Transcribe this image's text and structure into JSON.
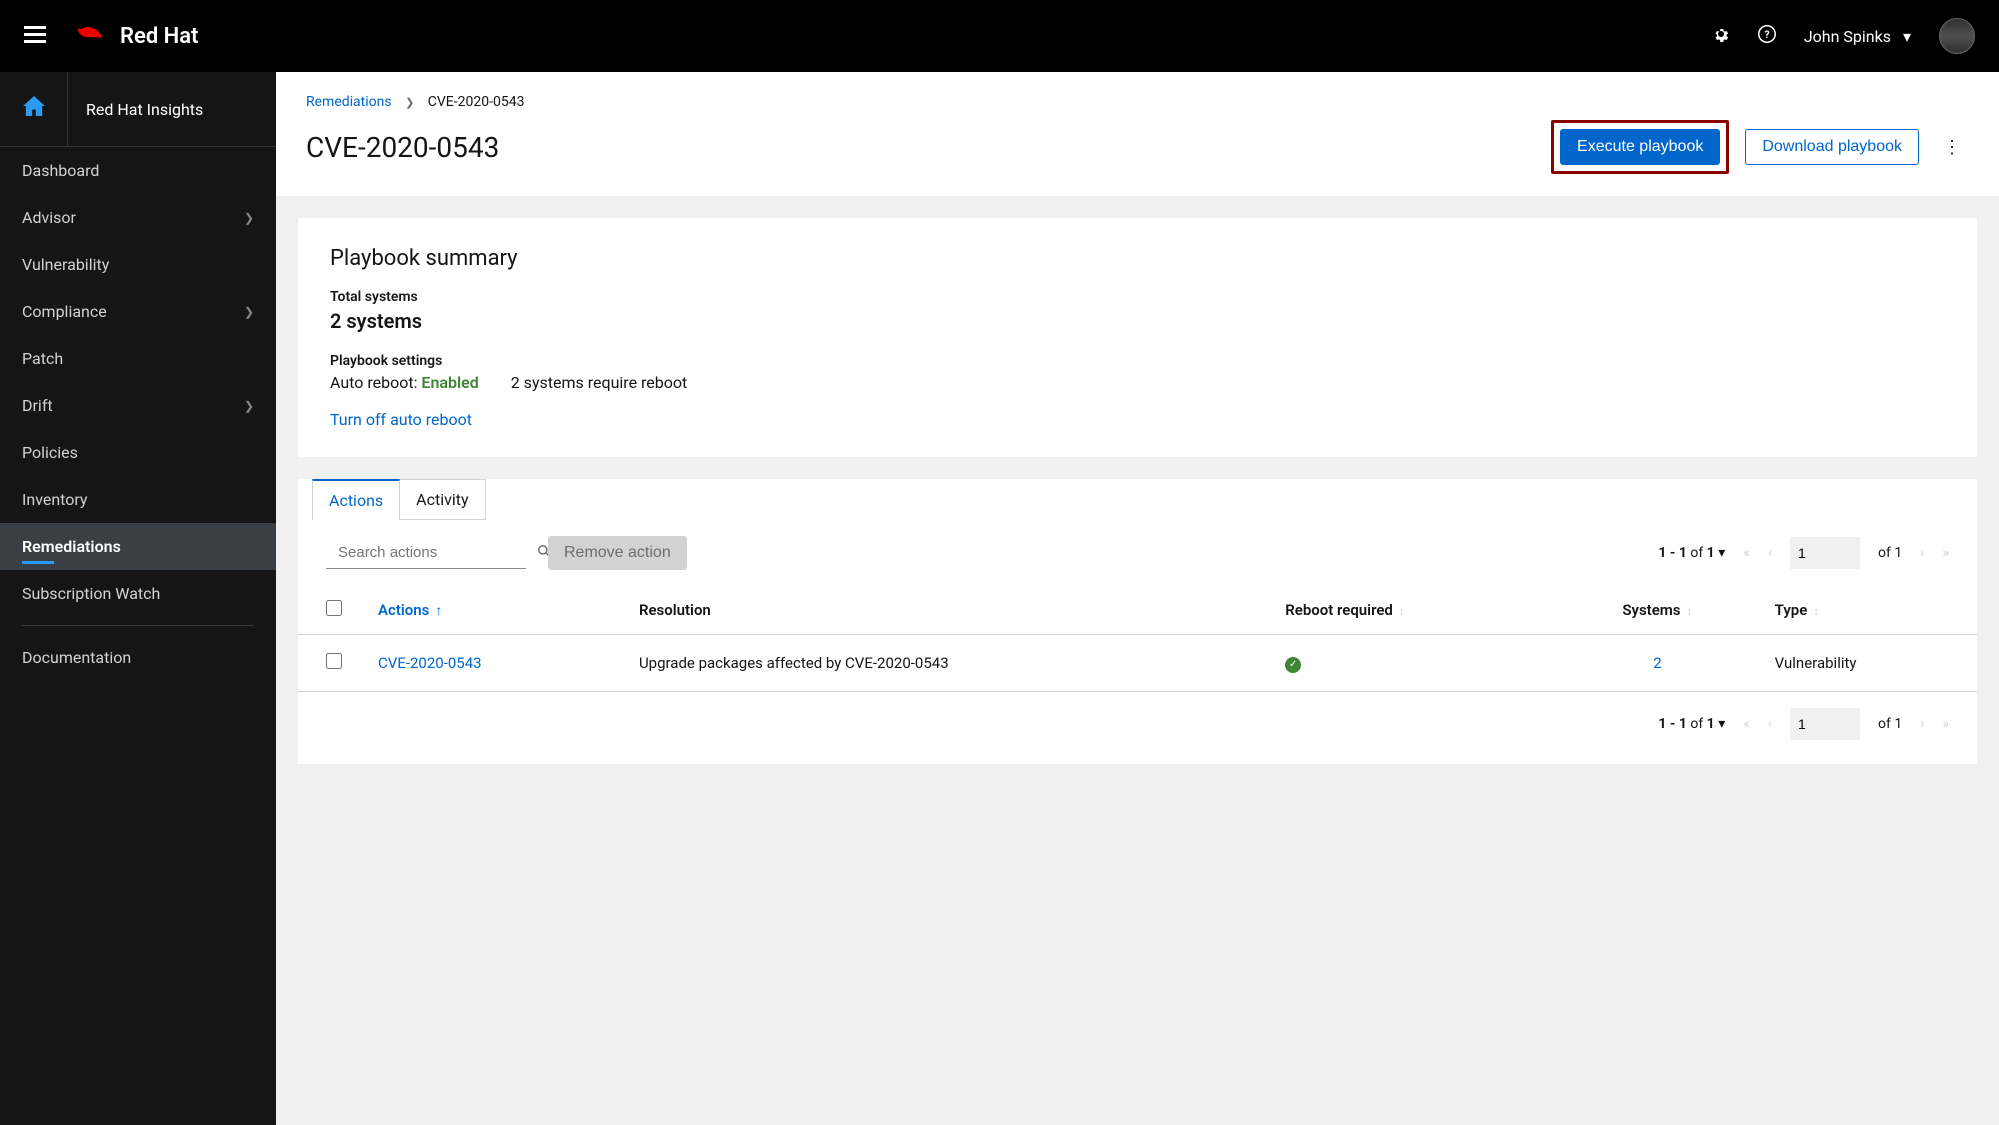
{
  "header": {
    "logo_text": "Red Hat",
    "user_name": "John Spinks"
  },
  "sidebar": {
    "title": "Red Hat Insights",
    "items": [
      {
        "label": "Dashboard",
        "expandable": false,
        "active": false
      },
      {
        "label": "Advisor",
        "expandable": true,
        "active": false
      },
      {
        "label": "Vulnerability",
        "expandable": false,
        "active": false
      },
      {
        "label": "Compliance",
        "expandable": true,
        "active": false
      },
      {
        "label": "Patch",
        "expandable": false,
        "active": false
      },
      {
        "label": "Drift",
        "expandable": true,
        "active": false
      },
      {
        "label": "Policies",
        "expandable": false,
        "active": false
      },
      {
        "label": "Inventory",
        "expandable": false,
        "active": false
      },
      {
        "label": "Remediations",
        "expandable": false,
        "active": true
      },
      {
        "label": "Subscription Watch",
        "expandable": false,
        "active": false
      }
    ],
    "documentation_label": "Documentation"
  },
  "breadcrumb": {
    "parent": "Remediations",
    "current": "CVE-2020-0543"
  },
  "page": {
    "title": "CVE-2020-0543",
    "execute_label": "Execute playbook",
    "download_label": "Download playbook"
  },
  "summary": {
    "card_title": "Playbook summary",
    "total_systems_label": "Total systems",
    "total_systems_value": "2 systems",
    "settings_label": "Playbook settings",
    "auto_reboot_label": "Auto reboot: ",
    "auto_reboot_value": "Enabled",
    "reboot_required_text": "2 systems require reboot",
    "turn_off_link": "Turn off auto reboot"
  },
  "tabs": {
    "actions": "Actions",
    "activity": "Activity"
  },
  "toolbar": {
    "search_placeholder": "Search actions",
    "remove_action_label": "Remove action"
  },
  "pagination": {
    "range_text": "1 - 1",
    "of_text": " of ",
    "total": "1",
    "page_value": "1",
    "page_of_text": "of 1"
  },
  "table": {
    "headers": {
      "actions": "Actions",
      "resolution": "Resolution",
      "reboot": "Reboot required",
      "systems": "Systems",
      "type": "Type"
    },
    "rows": [
      {
        "action": "CVE-2020-0543",
        "resolution": "Upgrade packages affected by CVE-2020-0543",
        "reboot_required": true,
        "systems": "2",
        "type": "Vulnerability"
      }
    ]
  }
}
